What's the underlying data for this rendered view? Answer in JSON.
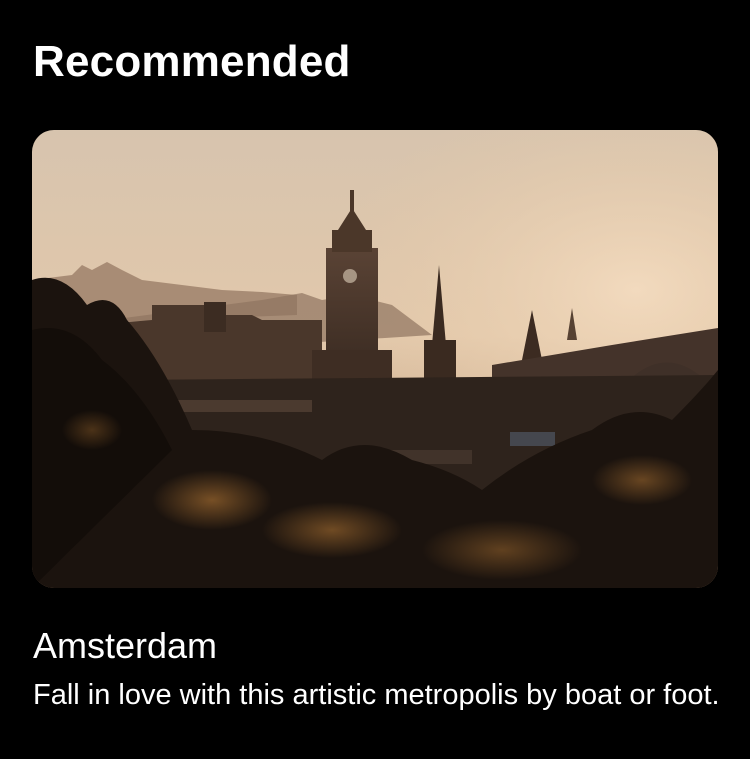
{
  "section": {
    "title": "Recommended"
  },
  "card": {
    "title": "Amsterdam",
    "description": "Fall in love with this artistic metropolis by boat or foot.",
    "image_subject": "city-skyline-at-sunset-photo",
    "colors": {
      "sky_top": "#d9c6b0",
      "sky_bottom": "#e6c9a6",
      "haze": "#b59b84",
      "silhouette": "#3b2a1f",
      "foliage_dark": "#1a120d",
      "foliage_glow": "#b8783a"
    }
  }
}
